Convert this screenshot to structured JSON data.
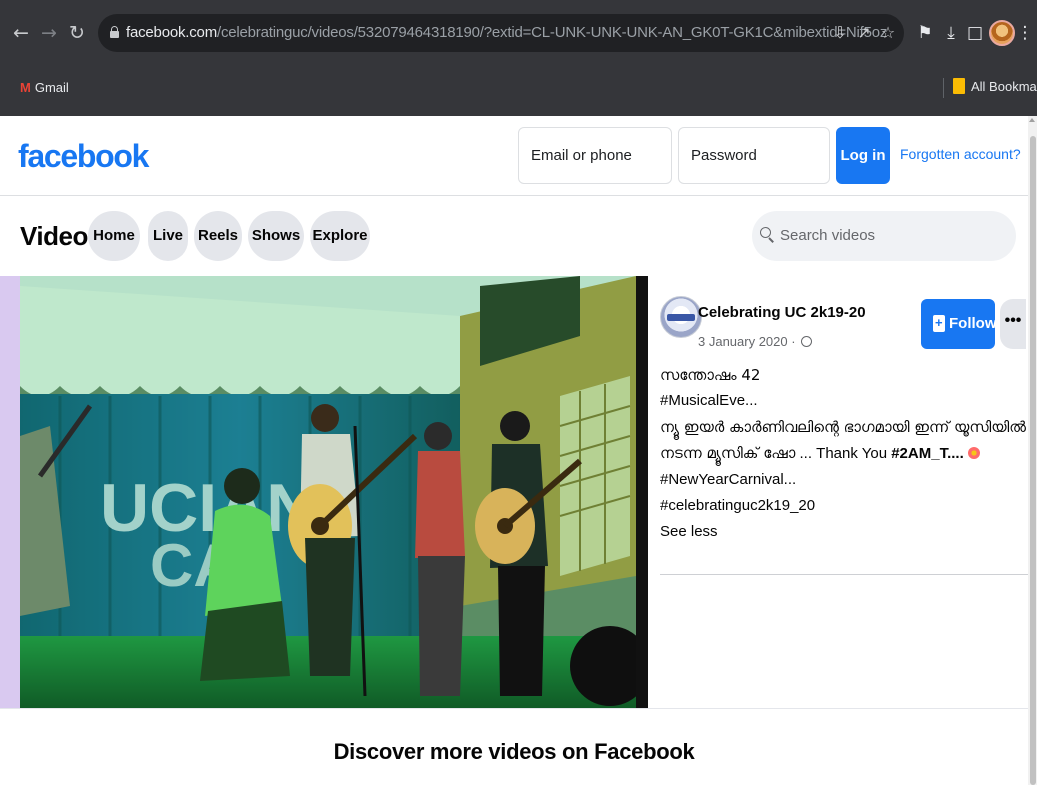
{
  "browser": {
    "url_host": "facebook.com",
    "url_path": "/celebratinguc/videos/532079464318190/?extid=CL-UNK-UNK-UNK-AN_GK0T-GK1C&mibextid=Nif5oz",
    "bookmark_gmail": "Gmail",
    "bookmark_all": "All Bookmarks"
  },
  "header": {
    "logo": "facebook",
    "email_placeholder": "Email or phone",
    "password_placeholder": "Password",
    "login_label": "Log in",
    "forgot_label": "Forgotten account?"
  },
  "video_nav": {
    "title": "Video",
    "tabs": [
      "Home",
      "Live",
      "Reels",
      "Shows",
      "Explore"
    ],
    "search_placeholder": "Search videos"
  },
  "video": {
    "banner_text_1": "UCIAN",
    "banner_text_2": "CA"
  },
  "post": {
    "page_name": "Celebrating UC 2k19-20",
    "date": "3 January 2020 ·",
    "line1": "സന്തോഷം 42",
    "line2": "#MusicalEve...",
    "line3": "ന്യൂ ഇയർ കാർണിവലിന്റെ ഭാഗമായി ഇന്ന് യൂസിയിൽ",
    "line4_mal": "നടന്ന മ്യൂസിക് ഷോ",
    "line4_rest": " ... Thank You ",
    "line4_bold": "#2AM_T....",
    "line5": "#NewYearCarnival...",
    "line6": "#celebratinguc2k19_20",
    "see_less": "See less",
    "follow_label": "Follow",
    "more_label": "•••"
  },
  "discover": {
    "title": "Discover more videos on Facebook"
  },
  "colors": {
    "brand": "#1877f2",
    "chrome_bg": "#35363a",
    "omnibox_bg": "#202124"
  },
  "icons": [
    "back-icon",
    "forward-icon",
    "reload-icon",
    "lock-icon",
    "install-icon",
    "share-icon",
    "star-icon",
    "extensions-icon",
    "download-icon",
    "sidepanel-icon",
    "menu-icon",
    "search-icon",
    "globe-icon",
    "follow-icon"
  ]
}
